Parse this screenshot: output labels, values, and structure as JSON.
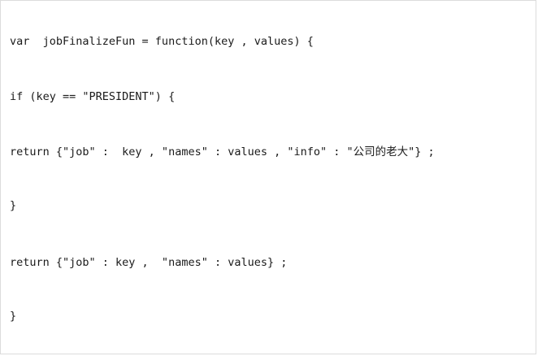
{
  "code": {
    "lines": [
      "var  jobFinalizeFun = function(key , values) {",
      "if (key == \"PRESIDENT\") {",
      "return {\"job\" :  key , \"names\" : values , \"info\" : \"公司的老大\"} ;",
      "}",
      "return {\"job\" : key ,  \"names\" : values} ;",
      "}"
    ]
  }
}
